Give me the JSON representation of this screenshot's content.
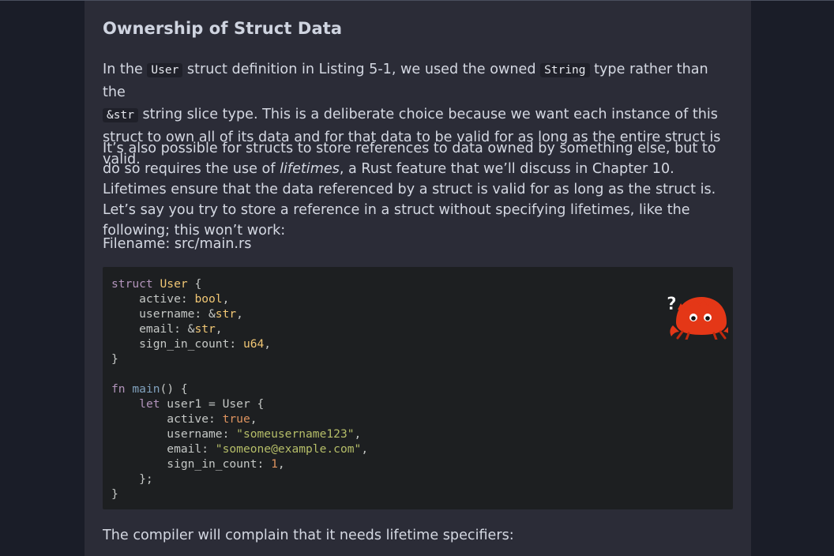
{
  "heading": "Ownership of Struct Data",
  "para1": {
    "t1": "In the ",
    "c1": "User",
    "t2": " struct definition in Listing 5-1, we used the owned ",
    "c2": "String",
    "t3": " type rather than the ",
    "c3": "&str",
    "t4": " string slice type. This is a deliberate choice because we want each instance of this struct to own all of its data and for that data to be valid for as long as the entire struct is valid."
  },
  "para2": {
    "t1": "It’s also possible for structs to store references to data owned by something else, but to do so requires the use of ",
    "em": "lifetimes",
    "t2": ", a Rust feature that we’ll discuss in Chapter 10. Lifetimes ensure that the data referenced by a struct is valid for as long as the struct is. Let’s say you try to store a reference in a struct without specifying lifetimes, like the following; this won’t work:"
  },
  "filename_label": "Filename: src/main.rs",
  "code_lines": [
    "struct User {",
    "    active: bool,",
    "    username: &str,",
    "    email: &str,",
    "    sign_in_count: u64,",
    "}",
    "",
    "fn main() {",
    "    let user1 = User {",
    "        active: true,",
    "        username: \"someusername123\",",
    "        email: \"someone@example.com\",",
    "        sign_in_count: 1,",
    "    };",
    "}"
  ],
  "ferris_badge": "?",
  "ferris_icon": "ferris-does-not-compile-icon",
  "para3": "The compiler will complain that it needs lifetime specifiers:",
  "colors": {
    "page_bg": "#2b2c37",
    "outer_bg": "#1a1d28",
    "code_bg": "#1d1f21",
    "keyword": "#b294bb",
    "type": "#f0c674",
    "number": "#de935f",
    "string": "#b5bd68",
    "ferris": "#e43717"
  }
}
